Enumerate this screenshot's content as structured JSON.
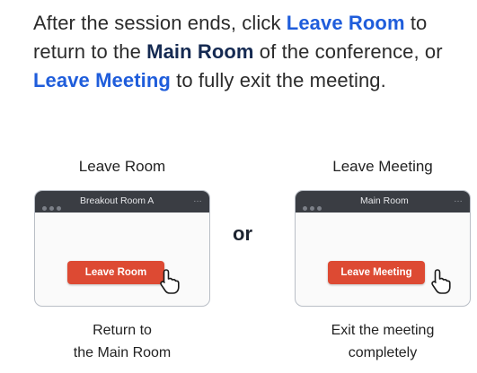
{
  "intro": {
    "part1": "After the session ends, click ",
    "leave_room": "Leave Room",
    "part2": " to return to the ",
    "main_room": "Main Room",
    "part3": " of the conference, or ",
    "leave_meeting": "Leave Meeting",
    "part4": " to fully exit the meeting."
  },
  "left": {
    "heading": "Leave Room",
    "window_title": "Breakout Room A",
    "more": "…",
    "button": "Leave Room",
    "caption_line1": "Return to",
    "caption_line2": "the Main Room"
  },
  "separator": "or",
  "right": {
    "heading": "Leave Meeting",
    "window_title": "Main Room",
    "more": "…",
    "button": "Leave Meeting",
    "caption_line1": "Exit the meeting",
    "caption_line2": "completely"
  },
  "colors": {
    "accent_blue": "#1f5ddb",
    "emphasis_navy": "#152a52",
    "button_red": "#dd4a33",
    "titlebar": "#3a3d43"
  },
  "icons": [
    "window-dots-icon",
    "pointer-cursor-icon"
  ]
}
